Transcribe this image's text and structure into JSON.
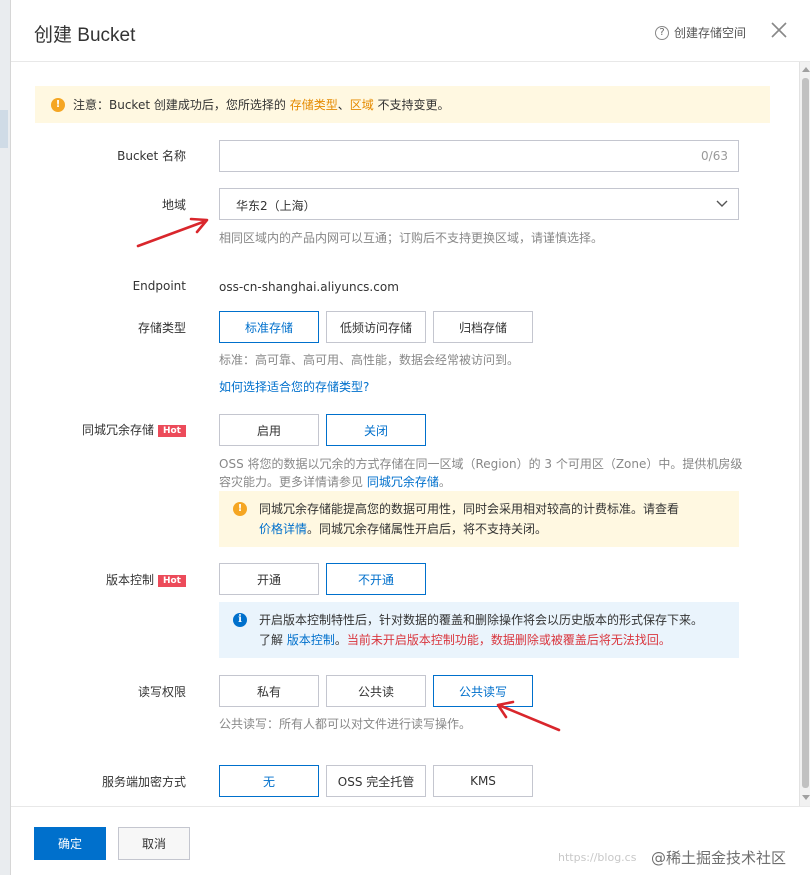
{
  "dialog": {
    "title": "创建 Bucket",
    "help_link": "创建存储空间"
  },
  "notice": {
    "prefix": "注意：Bucket 创建成功后，您所选择的 ",
    "hl1": "存储类型",
    "sep": "、",
    "hl2": "区域",
    "suffix": " 不支持变更。"
  },
  "bucket_name": {
    "label": "Bucket 名称",
    "value": "",
    "count": "0/63"
  },
  "region": {
    "label": "地域",
    "value": "华东2（上海）",
    "help": "相同区域内的产品内网可以互通；订购后不支持更换区域，请谨慎选择。"
  },
  "endpoint": {
    "label": "Endpoint",
    "value": "oss-cn-shanghai.aliyuncs.com"
  },
  "storage_class": {
    "label": "存储类型",
    "options": [
      "标准存储",
      "低频访问存储",
      "归档存储"
    ],
    "selected": 0,
    "help": "标准：高可靠、高可用、高性能，数据会经常被访问到。",
    "link": "如何选择适合您的存储类型?"
  },
  "zrs": {
    "label": "同城冗余存储",
    "hot": "Hot",
    "options": [
      "启用",
      "关闭"
    ],
    "selected": 1,
    "help_line1": "OSS 将您的数据以冗余的方式存储在同一区域（Region）的 3 个可用区（Zone）中。提供机房级",
    "help_line2_prefix": "容灾能力。更多详情请参见 ",
    "help_link": "同城冗余存储",
    "help_line2_suffix": "。",
    "tip_line1": "同城冗余存储能提高您的数据可用性，同时会采用相对较高的计费标准。请查看",
    "tip_link": "价格详情",
    "tip_line2": "。同城冗余存储属性开启后，将不支持关闭。"
  },
  "versioning": {
    "label": "版本控制",
    "hot": "Hot",
    "options": [
      "开通",
      "不开通"
    ],
    "selected": 1,
    "tip_line1": "开启版本控制特性后，针对数据的覆盖和删除操作将会以历史版本的形式保存下来。",
    "tip_prefix": "了解 ",
    "tip_link": "版本控制",
    "tip_sep": "。",
    "tip_warn": "当前未开启版本控制功能，数据删除或被覆盖后将无法找回。"
  },
  "acl": {
    "label": "读写权限",
    "options": [
      "私有",
      "公共读",
      "公共读写"
    ],
    "selected": 2,
    "warn": "公共读写：所有人都可以对文件进行读写操作。"
  },
  "encryption": {
    "label": "服务端加密方式",
    "options": [
      "无",
      "OSS 完全托管",
      "KMS"
    ],
    "selected": 0
  },
  "footer": {
    "confirm": "确定",
    "cancel": "取消"
  },
  "watermark": {
    "url": "https://blog.cs",
    "name": "@稀土掘金技术社区"
  },
  "colors": {
    "primary": "#0070cc",
    "warning_bg": "#fff8e1",
    "info_bg": "#eaf4fc",
    "hot_badge": "#ec4b5a",
    "orange_text": "#e58a00",
    "red_text": "#d9363e"
  }
}
